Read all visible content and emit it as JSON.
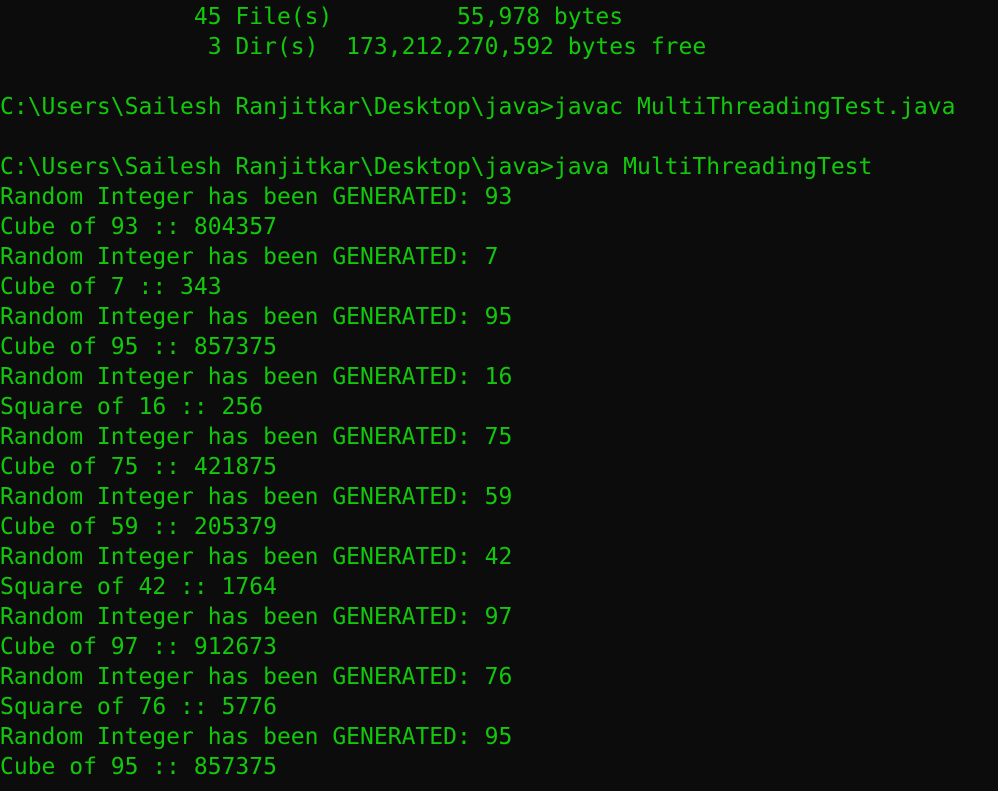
{
  "terminal": {
    "text_color": "#13c70c",
    "background_color": "#0c0c0c",
    "lines": [
      "              45 File(s)         55,978 bytes",
      "               3 Dir(s)  173,212,270,592 bytes free",
      "",
      "C:\\Users\\Sailesh Ranjitkar\\Desktop\\java>javac MultiThreadingTest.java",
      "",
      "C:\\Users\\Sailesh Ranjitkar\\Desktop\\java>java MultiThreadingTest",
      "Random Integer has been GENERATED: 93",
      "Cube of 93 :: 804357",
      "Random Integer has been GENERATED: 7",
      "Cube of 7 :: 343",
      "Random Integer has been GENERATED: 95",
      "Cube of 95 :: 857375",
      "Random Integer has been GENERATED: 16",
      "Square of 16 :: 256",
      "Random Integer has been GENERATED: 75",
      "Cube of 75 :: 421875",
      "Random Integer has been GENERATED: 59",
      "Cube of 59 :: 205379",
      "Random Integer has been GENERATED: 42",
      "Square of 42 :: 1764",
      "Random Integer has been GENERATED: 97",
      "Cube of 97 :: 912673",
      "Random Integer has been GENERATED: 76",
      "Square of 76 :: 5776",
      "Random Integer has been GENERATED: 95",
      "Cube of 95 :: 857375"
    ]
  }
}
